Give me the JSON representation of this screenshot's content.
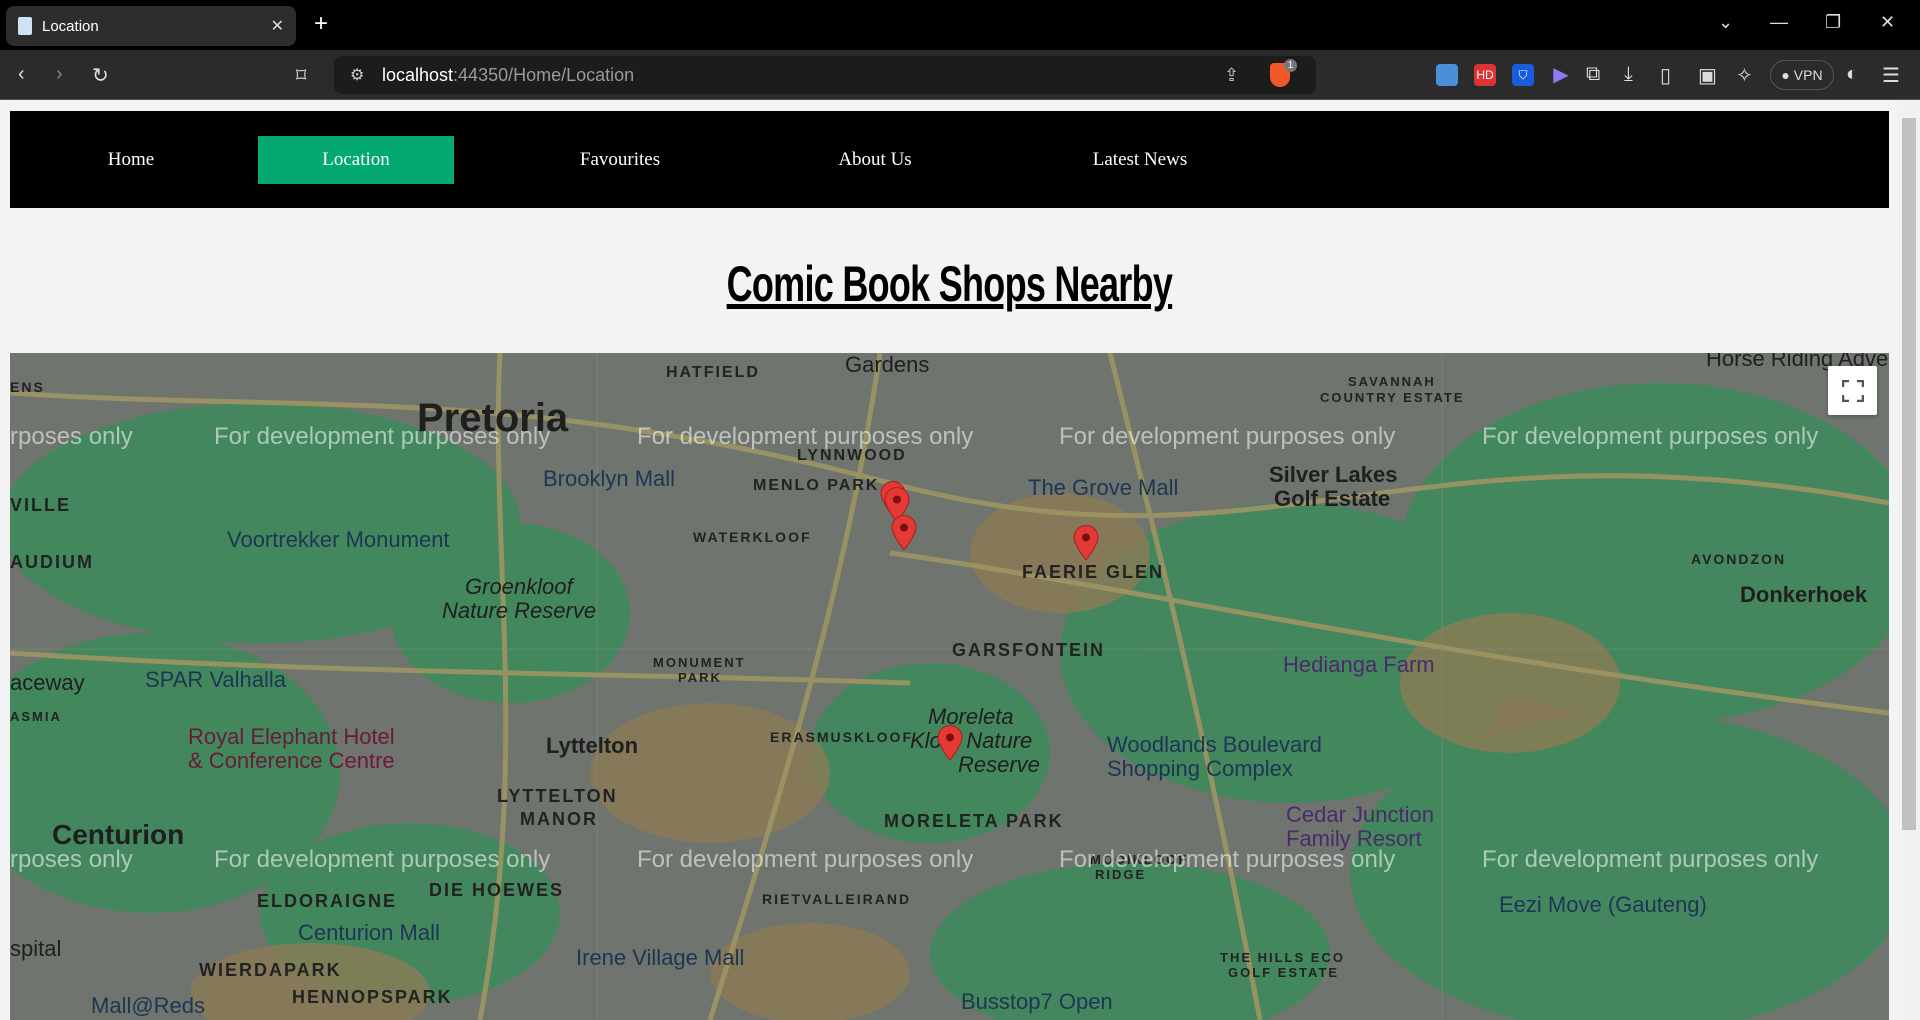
{
  "browser": {
    "tab_title": "Location",
    "url_host": "localhost",
    "url_path": ":44350/Home/Location",
    "vpn_label": "VPN",
    "brave_badge": "1"
  },
  "nav": {
    "items": [
      {
        "label": "Home"
      },
      {
        "label": "Location",
        "active": true
      },
      {
        "label": "Favourites"
      },
      {
        "label": "About Us"
      },
      {
        "label": "Latest News"
      }
    ],
    "accent": "#03a96e"
  },
  "page": {
    "title": "Comic Book Shops Nearby"
  },
  "map": {
    "watermark": "For development purposes only",
    "watermark_partial": "rposes only",
    "labels": [
      "Pretoria",
      "Gardens",
      "HATFIELD",
      "LYNNWOOD",
      "MENLO PARK",
      "Brooklyn Mall",
      "The Grove Mall",
      "Silver Lakes",
      "Golf Estate",
      "SAVANNAH",
      "COUNTRY ESTATE",
      "Voortrekker Monument",
      "WATERKLOOF",
      "FAERIE GLEN",
      "AVONDZON",
      "Donkerhoek",
      "Groenkloof",
      "Nature Reserve",
      "GARSFONTEIN",
      "MONUMENT",
      "PARK",
      "Hedianga Farm",
      "SPAR Valhalla",
      "Royal Elephant Hotel",
      "& Conference Centre",
      "Lyttelton",
      "ERASMUSKLOOF",
      "Moreleta",
      "Kloof Nature",
      "Reserve",
      "Woodlands Boulevard",
      "Shopping Complex",
      "LYTTELTON",
      "MANOR",
      "MORELETA PARK",
      "Cedar Junction",
      "Family Resort",
      "Centurion",
      "ELDORAIGNE",
      "DIE HOEWES",
      "RIETVALLEIRAND",
      "MOOIKLOOF",
      "RIDGE",
      "Eezi Move (Gauteng)",
      "Centurion Mall",
      "Irene Village Mall",
      "THE HILLS ECO",
      "GOLF ESTATE",
      "WIERDAPARK",
      "HENNOPSPARK",
      "Mall@Reds",
      "Busstop7 Open",
      "ENS",
      "VILLE",
      "AUDIUM",
      "aceway",
      "ASMIA",
      "spital",
      "Horse Riding Adve"
    ],
    "markers": 5,
    "marker_color": "#e53935"
  }
}
